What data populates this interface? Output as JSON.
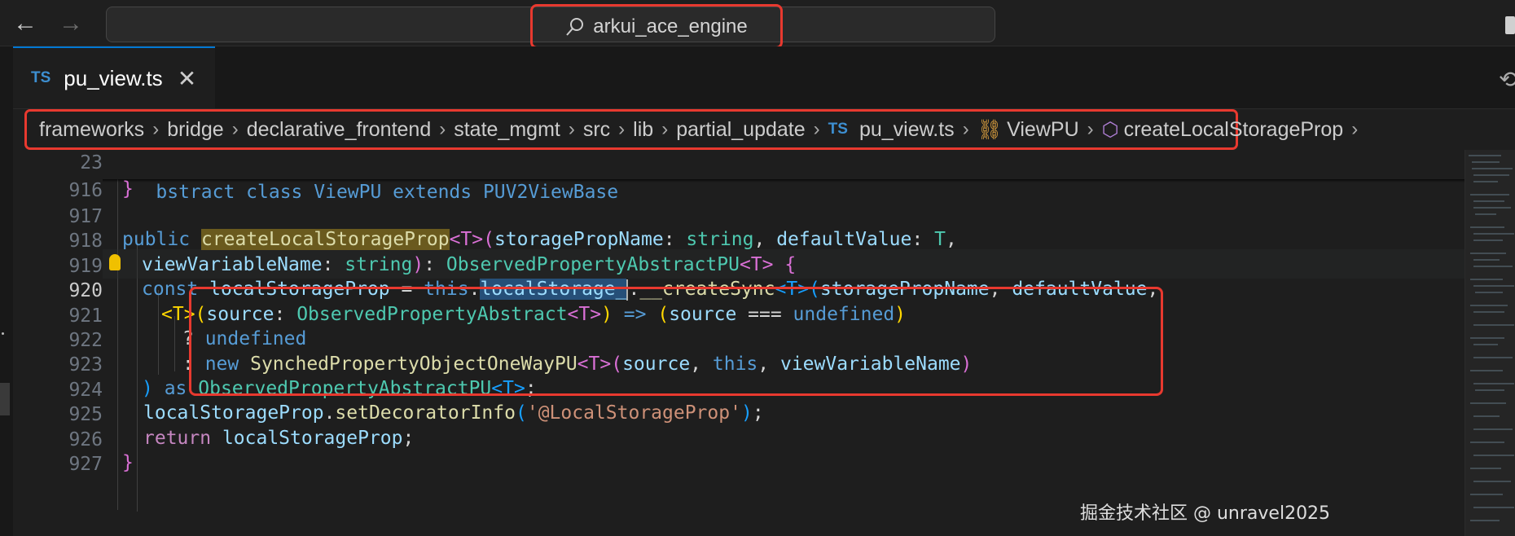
{
  "titlebar": {
    "search_text": "arkui_ace_engine"
  },
  "tab": {
    "language_badge": "TS",
    "filename": "pu_view.ts",
    "close_glyph": "✕"
  },
  "breadcrumbs": {
    "items": [
      "frameworks",
      "bridge",
      "declarative_frontend",
      "state_mgmt",
      "src",
      "lib",
      "partial_update"
    ],
    "file_badge": "TS",
    "file": "pu_view.ts",
    "class": "ViewPU",
    "method": "createLocalStorageProp",
    "separator": "›"
  },
  "editor": {
    "sticky_line_number": "23",
    "sticky_line_text": "bstract class ViewPU extends PUV2ViewBase",
    "line_numbers": [
      "916",
      "917",
      "918",
      "919",
      "920",
      "921",
      "922",
      "923",
      "924",
      "925",
      "926",
      "927"
    ],
    "active_line": "920",
    "lines": {
      "l916": "}",
      "l918a": "public ",
      "l918b": "createLocalStorageProp",
      "l918c": "<T>",
      "l918d": "(",
      "l918e": "storagePropName",
      "l918f": ": ",
      "l918g": "string",
      "l918h": ", ",
      "l918i": "defaultValue",
      "l918j": ": ",
      "l918k": "T",
      "l918l": ",",
      "l919a": "viewVariableName",
      "l919b": ": ",
      "l919c": "string",
      "l919d": ")",
      "l919e": ": ",
      "l919f": "ObservedPropertyAbstractPU",
      "l919g": "<T>",
      "l919h": " {",
      "l920a": "const ",
      "l920b": "localStorageProp",
      "l920c": " = ",
      "l920d": "this",
      "l920e": ".",
      "l920f": "localStorage_",
      "l920g": ".",
      "l920h": "__createSync",
      "l920i": "<T>",
      "l920j": "(",
      "l920k": "storagePropName",
      "l920l": ", ",
      "l920m": "defaultValue",
      "l920n": ",",
      "l921a": "<T>",
      "l921b": "(",
      "l921c": "source",
      "l921d": ": ",
      "l921e": "ObservedPropertyAbstract",
      "l921f": "<T>",
      "l921g": ")",
      "l921h": " => ",
      "l921i": "(",
      "l921j": "source",
      "l921k": " === ",
      "l921l": "undefined",
      "l921m": ")",
      "l922a": "? ",
      "l922b": "undefined",
      "l923a": ": ",
      "l923b": "new ",
      "l923c": "SynchedPropertyObjectOneWayPU",
      "l923d": "<T>",
      "l923e": "(",
      "l923f": "source",
      "l923g": ", ",
      "l923h": "this",
      "l923i": ", ",
      "l923j": "viewVariableName",
      "l923k": ")",
      "l924a": ")",
      "l924b": " as ",
      "l924c": "ObservedPropertyAbstractPU",
      "l924d": "<T>",
      "l924e": ";",
      "l925a": "localStorageProp",
      "l925b": ".",
      "l925c": "setDecoratorInfo",
      "l925d": "(",
      "l925e": "'@LocalStorageProp'",
      "l925f": ")",
      "l925g": ";",
      "l926a": "return ",
      "l926b": "localStorageProp",
      "l926c": ";",
      "l927": "}"
    }
  },
  "watermark": "掘金技术社区 @ unravel2025",
  "colors": {
    "highlight_border": "#e8392f",
    "keyword": "#569cd6",
    "type": "#4ec9b0",
    "function": "#dcdcaa",
    "variable": "#9cdcfe",
    "string": "#ce9178"
  }
}
